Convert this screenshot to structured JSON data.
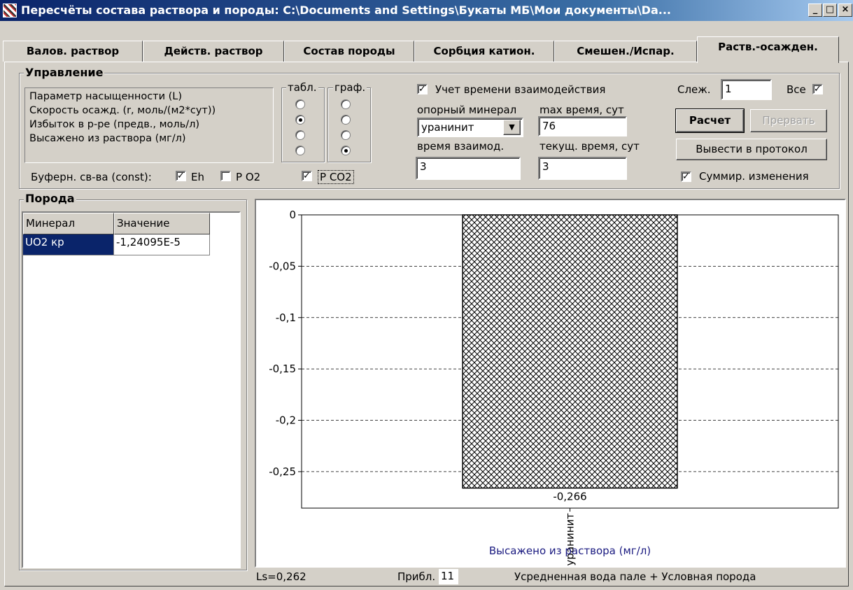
{
  "window": {
    "title": "Пересчёты состава раствора и породы: C:\\Documents and Settings\\Букаты МБ\\Мои документы\\Da...",
    "buttons": {
      "minimize": "_",
      "maximize": "□",
      "close": "×"
    }
  },
  "tabs": [
    {
      "label": "Валов. раствор",
      "active": false
    },
    {
      "label": "Действ. раствор",
      "active": false
    },
    {
      "label": "Состав породы",
      "active": false
    },
    {
      "label": "Сорбция катион.",
      "active": false
    },
    {
      "label": "Смешен./Испар.",
      "active": false
    },
    {
      "label": "Раств.-осажден.",
      "active": true
    }
  ],
  "control": {
    "group_label": "Управление",
    "parameters": [
      "Параметр насыщенности (L)",
      "Скорость осажд. (r, моль/(м2*сут))",
      "Избыток в р-ре (предв., моль/л)",
      "Высажено из раствора (мг/л)"
    ],
    "col_table_label": "табл.",
    "col_graph_label": "граф.",
    "table_radio_selected": 1,
    "graph_radio_selected": 3,
    "buffer_label": "Буферн. св-ва (const):",
    "buffer": [
      {
        "label": "Eh",
        "checked": true
      },
      {
        "label": "P O2",
        "checked": false
      },
      {
        "label": "P CO2",
        "checked": true
      }
    ],
    "time_check": {
      "label": "Учет времени взаимодействия",
      "checked": true
    },
    "ref_mineral_label": "опорный минерал",
    "ref_mineral_value": "уранинит",
    "max_time_label": "max время, сут",
    "max_time_value": "76",
    "interaction_time_label": "время взаимод.",
    "interaction_time_value": "3",
    "current_time_label": "текущ. время, сут",
    "current_time_value": "3",
    "track_label": "Слеж.",
    "track_value": "1",
    "all_label": "Все",
    "all_checked": true,
    "calc_button": "Расчет",
    "interrupt_button": "Прервать",
    "protocol_button": "Вывести в протокол",
    "summ_check": {
      "label": "Суммир. изменения",
      "checked": true
    }
  },
  "rock": {
    "group_label": "Порода",
    "columns": [
      "Минерал",
      "Значение"
    ],
    "rows": [
      {
        "mineral": "UO2 кр",
        "value": "-1,24095E-5"
      }
    ]
  },
  "chart_data": {
    "type": "bar",
    "categories": [
      "уранинит"
    ],
    "values": [
      -0.266
    ],
    "value_labels": [
      "-0,266"
    ],
    "yticks": [
      "0",
      "-0,05",
      "-0,1",
      "-0,15",
      "-0,2",
      "-0,25"
    ],
    "ytick_values": [
      0,
      -0.05,
      -0.1,
      -0.15,
      -0.2,
      -0.25
    ],
    "ylim": [
      -0.2855,
      0
    ],
    "grid": true,
    "xlabel": "Высажено из раствора (мг/л)",
    "bar_fill": "crosshatch",
    "xlabel_color": "#1a1a80"
  },
  "status": {
    "ls": "Ls=0,262",
    "approx_label": "Прибл.",
    "approx_value": "11",
    "description": "Усредненная вода пале + Условная порода"
  }
}
